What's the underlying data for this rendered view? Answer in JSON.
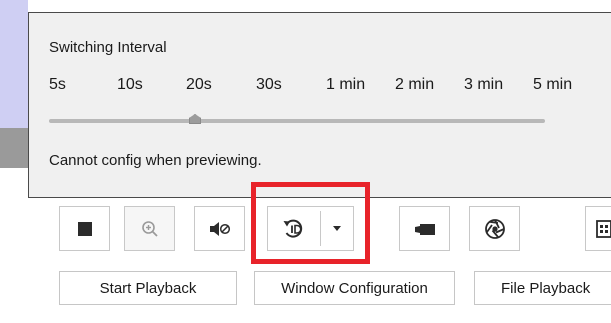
{
  "popup": {
    "title": "Switching Interval",
    "intervals": [
      "5s",
      "10s",
      "20s",
      "30s",
      "1 min",
      "2 min",
      "3 min",
      "5 min"
    ],
    "selected_interval": "20s",
    "note": "Cannot config when previewing."
  },
  "toolbar": {
    "buttons": [
      {
        "name": "stop",
        "icon": "stop-icon"
      },
      {
        "name": "digital-zoom",
        "icon": "zoom-in-icon",
        "disabled": true
      },
      {
        "name": "audio",
        "icon": "speaker-mute-icon"
      },
      {
        "name": "auto-switch",
        "icon": "auto-switch-icon",
        "has_dropdown": true,
        "highlighted": true
      },
      {
        "name": "capture",
        "icon": "camera-icon"
      },
      {
        "name": "record",
        "icon": "aperture-icon"
      },
      {
        "name": "more",
        "icon": "layout-icon"
      }
    ],
    "highlight_color": "#e8232a"
  },
  "bottom_buttons": {
    "start_playback": "Start Playback",
    "window_configuration": "Window Configuration",
    "file_playback": "File Playback"
  }
}
